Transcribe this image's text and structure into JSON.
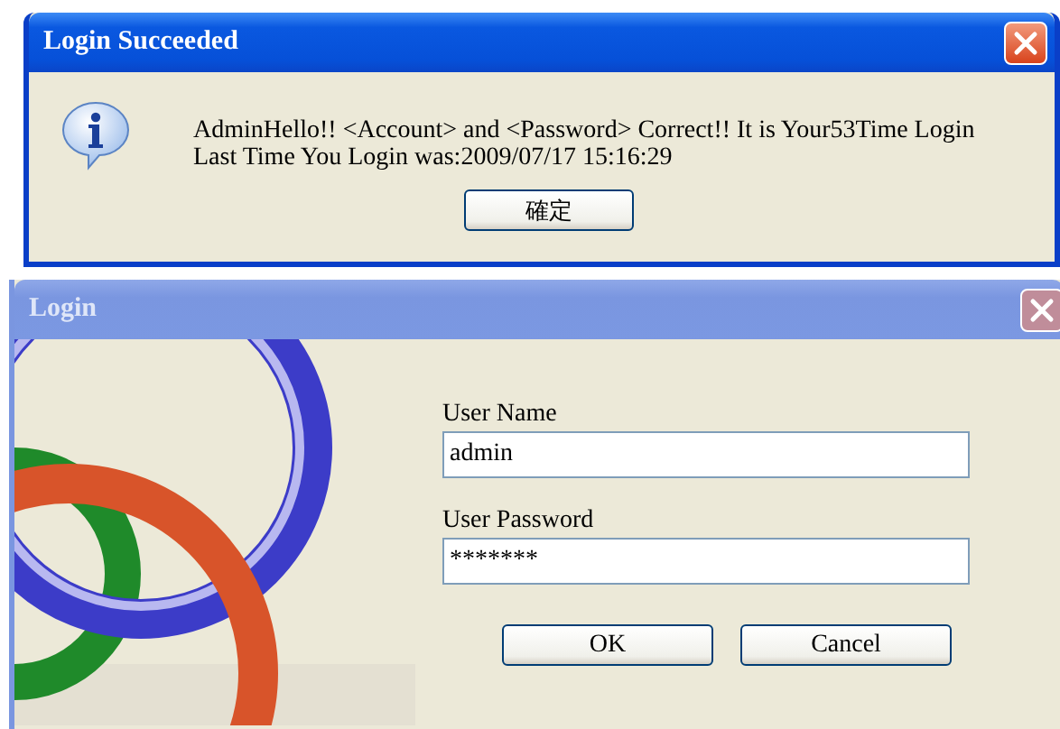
{
  "message_dialog": {
    "title": "Login Succeeded",
    "lines": [
      "AdminHello!! <Account> and <Password> Correct!! It is Your53Time Login",
      "Last Time You Login was:2009/07/17 15:16:29"
    ],
    "button": "確定"
  },
  "login_dialog": {
    "title": "Login",
    "fields": [
      {
        "label": "User Name",
        "value": "admin"
      },
      {
        "label": "User Password",
        "value": "*******"
      }
    ],
    "buttons": [
      "OK",
      "Cancel"
    ]
  }
}
